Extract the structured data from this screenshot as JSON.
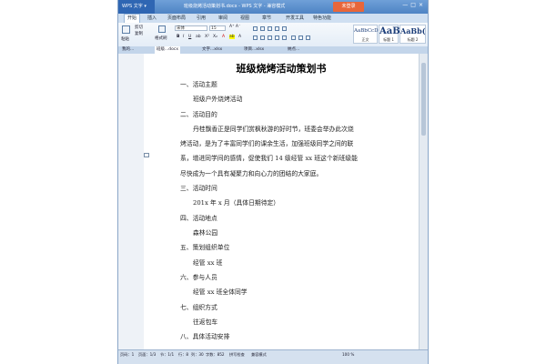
{
  "app": {
    "app_name": "WPS 文字",
    "title": "班级烧烤活动策划书.docx - WPS 文字 - 兼容模式",
    "not_logged_in": "未登录"
  },
  "menu": [
    "开始",
    "插入",
    "页面布局",
    "引用",
    "审阅",
    "视图",
    "章节",
    "开发工具",
    "特色功能"
  ],
  "ribbon": {
    "paste": "粘贴",
    "cut": "剪切",
    "copy": "复制",
    "format_painter": "格式刷",
    "font_name": "宋体",
    "font_size": "15",
    "styles": [
      {
        "sample": "AaBbCcD",
        "label": "正文"
      },
      {
        "sample": "AaB",
        "label": "标题 1"
      },
      {
        "sample": "AaBb(",
        "label": "标题 2"
      }
    ]
  },
  "tabs": [
    "我的...",
    "班级...docx",
    "文字...xlsx",
    "项目...xlsx",
    "纳点..."
  ],
  "document": {
    "title": "班级烧烤活动策划书",
    "lines": [
      "一、活动主题",
      "班级户外烧烤活动",
      "二、活动目的",
      "丹桂飘香正是同学们赏枫秋游的好时节，班委会举办此次烧",
      "烤活动，是为了丰富同学们的课余生活，加强班级同学之间的联",
      "系，增进同学间的感情，促使我们 14 级经管 xx 班这个新班级能",
      "尽快成为一个具有凝聚力和向心力的团结的大家庭。",
      "三、活动时间",
      "201x 年 x 月（具体日期待定）",
      "四、活动地点",
      "森林公园",
      "五、策划组织单位",
      "经管 xx 班",
      "六、参与人员",
      "经管 xx 班全体同学",
      "七、组织方式",
      "往返包车",
      "八、具体活动安排"
    ]
  },
  "status": {
    "page_num": "页码：1",
    "pages": "页面：1/3",
    "section": "节：1/1",
    "row": "行：8",
    "col": "列：30",
    "word_count": "字数：852",
    "spell_check": "拼写检查",
    "compat_mode": "兼容模式",
    "zoom": "100 %"
  }
}
